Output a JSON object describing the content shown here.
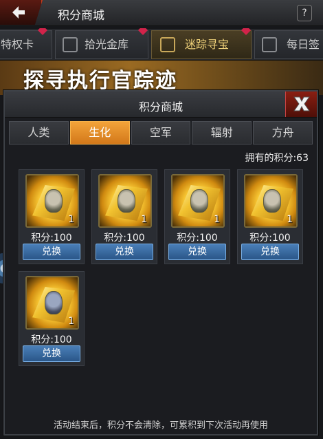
{
  "topbar": {
    "title": "积分商城",
    "help": "?"
  },
  "bg_tabs": [
    {
      "label": "特权卡"
    },
    {
      "label": "拾光金库"
    },
    {
      "label": "迷踪寻宝"
    },
    {
      "label": "每日签"
    }
  ],
  "banner": {
    "text": "探寻执行官踪迹"
  },
  "dialog": {
    "title": "积分商城",
    "tabs": [
      "人类",
      "生化",
      "空军",
      "辐射",
      "方舟"
    ],
    "active_tab": "生化",
    "points_label": "拥有的积分:63",
    "items": [
      {
        "qty": "1",
        "cost": "积分:100",
        "button": "兑换"
      },
      {
        "qty": "1",
        "cost": "积分:100",
        "button": "兑换"
      },
      {
        "qty": "1",
        "cost": "积分:100",
        "button": "兑换"
      },
      {
        "qty": "1",
        "cost": "积分:100",
        "button": "兑换"
      },
      {
        "qty": "1",
        "cost": "积分:100",
        "button": "兑换"
      }
    ],
    "footer": "活动结束后，积分不会清除，可累积到下次活动再使用"
  },
  "colors": {
    "accent_orange": "#e8902a",
    "button_blue": "#3a6ea8",
    "close_red": "#8a1f12"
  }
}
